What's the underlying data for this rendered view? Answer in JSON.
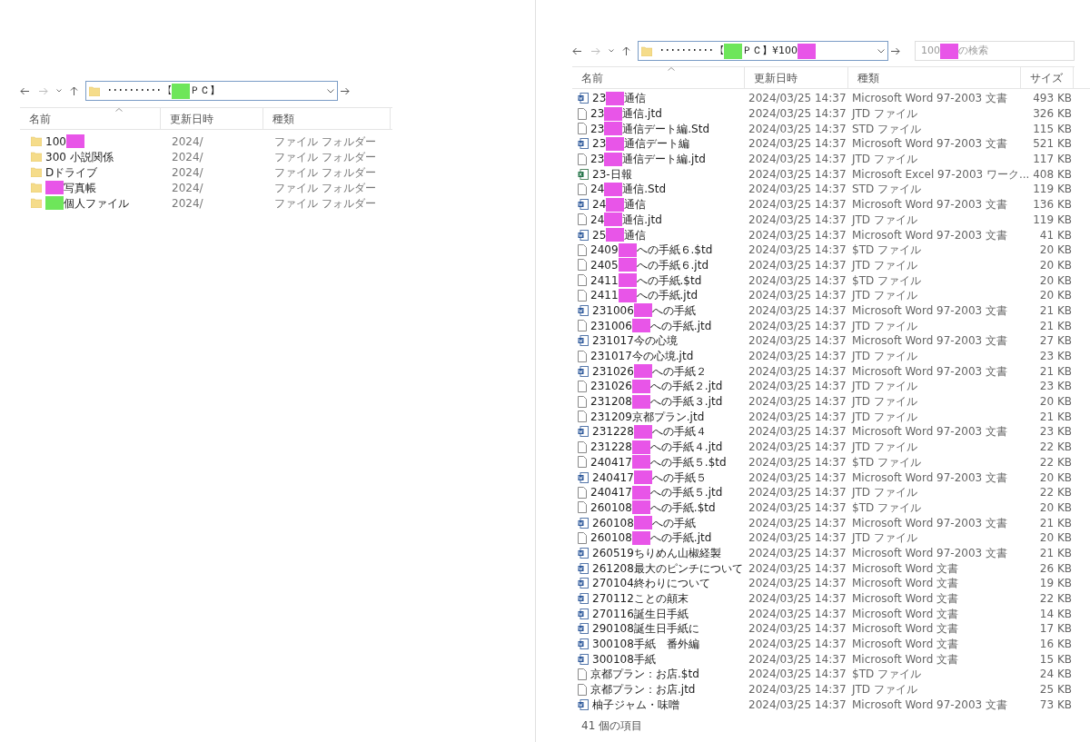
{
  "left_window": {
    "address": {
      "segments": [
        {
          "kind": "text",
          "text": "･･････････【"
        },
        {
          "kind": "redaction",
          "color": "#6ee65a"
        },
        {
          "kind": "text",
          "text": "ＰＣ】"
        }
      ]
    },
    "columns": [
      "名前",
      "更新日時",
      "種類"
    ],
    "rows": [
      {
        "kind": "folder",
        "name": "100",
        "color": "#e855e8",
        "date": "2024/",
        "type": "ファイル フォルダー"
      },
      {
        "kind": "folder",
        "name": "300 小説関係",
        "date": "2024/",
        "type": "ファイル フォルダー"
      },
      {
        "kind": "folder",
        "name": "Dドライブ",
        "date": "2024/",
        "type": "ファイル フォルダー"
      },
      {
        "kind": "folder",
        "color": "#e855e8",
        "name_end": "写真帳",
        "date": "2024/",
        "type": "ファイル フォルダー"
      },
      {
        "kind": "folder",
        "color": "#6ee65a",
        "name_end": "個人ファイル",
        "date": "2024/",
        "type": "ファイル フォルダー"
      }
    ]
  },
  "right_window": {
    "address": {
      "segments": [
        {
          "kind": "text",
          "text": "･･････････【"
        },
        {
          "kind": "redaction",
          "color": "#6ee65a"
        },
        {
          "kind": "text",
          "text": "ＰＣ】¥100"
        },
        {
          "kind": "redaction",
          "color": "#e855e8"
        }
      ]
    },
    "search": {
      "segments": [
        {
          "kind": "text",
          "text": "100"
        },
        {
          "kind": "redaction",
          "color": "#e855e8"
        },
        {
          "kind": "text",
          "text": "の検索"
        }
      ]
    },
    "columns": [
      "名前",
      "更新日時",
      "種類",
      "サイズ"
    ],
    "rows": [
      {
        "kind": "word",
        "name": "23",
        "color": "#e855e8",
        "name_end": "通信",
        "date": "2024/03/25 14:37",
        "type": "Microsoft Word 97-2003 文書",
        "size": "493 KB"
      },
      {
        "kind": "file",
        "name": "23",
        "color": "#e855e8",
        "name_end": "通信.jtd",
        "date": "2024/03/25 14:37",
        "type": "JTD ファイル",
        "size": "326 KB"
      },
      {
        "kind": "file",
        "name": "23",
        "color": "#e855e8",
        "name_end": "通信デート編.Std",
        "date": "2024/03/25 14:37",
        "type": "STD ファイル",
        "size": "115 KB"
      },
      {
        "kind": "word",
        "name": "23",
        "color": "#e855e8",
        "name_end": "通信デート編",
        "date": "2024/03/25 14:37",
        "type": "Microsoft Word 97-2003 文書",
        "size": "521 KB"
      },
      {
        "kind": "file",
        "name": "23",
        "color": "#e855e8",
        "name_end": "通信デート編.jtd",
        "date": "2024/03/25 14:37",
        "type": "JTD ファイル",
        "size": "117 KB"
      },
      {
        "kind": "excel",
        "name": "23-日報",
        "date": "2024/03/25 14:37",
        "type": "Microsoft Excel 97-2003 ワーク...",
        "size": "408 KB"
      },
      {
        "kind": "file",
        "name": "24",
        "color": "#e855e8",
        "name_end": "通信.Std",
        "date": "2024/03/25 14:37",
        "type": "STD ファイル",
        "size": "119 KB"
      },
      {
        "kind": "word",
        "name": "24",
        "color": "#e855e8",
        "name_end": "通信",
        "date": "2024/03/25 14:37",
        "type": "Microsoft Word 97-2003 文書",
        "size": "136 KB"
      },
      {
        "kind": "file",
        "name": "24",
        "color": "#e855e8",
        "name_end": "通信.jtd",
        "date": "2024/03/25 14:37",
        "type": "JTD ファイル",
        "size": "119 KB"
      },
      {
        "kind": "word",
        "name": "25",
        "color": "#e855e8",
        "name_end": "通信",
        "date": "2024/03/25 14:37",
        "type": "Microsoft Word 97-2003 文書",
        "size": "41 KB"
      },
      {
        "kind": "file",
        "name": "2409",
        "color": "#e855e8",
        "name_end": "への手紙６.$td",
        "date": "2024/03/25 14:37",
        "type": "$TD ファイル",
        "size": "20 KB"
      },
      {
        "kind": "file",
        "name": "2405",
        "color": "#e855e8",
        "name_end": "への手紙６.jtd",
        "date": "2024/03/25 14:37",
        "type": "JTD ファイル",
        "size": "20 KB"
      },
      {
        "kind": "file",
        "name": "2411",
        "color": "#e855e8",
        "name_end": "への手紙.$td",
        "date": "2024/03/25 14:37",
        "type": "$TD ファイル",
        "size": "20 KB"
      },
      {
        "kind": "file",
        "name": "2411",
        "color": "#e855e8",
        "name_end": "への手紙.jtd",
        "date": "2024/03/25 14:37",
        "type": "JTD ファイル",
        "size": "20 KB"
      },
      {
        "kind": "word",
        "name": "231006",
        "color": "#e855e8",
        "name_end": "への手紙",
        "date": "2024/03/25 14:37",
        "type": "Microsoft Word 97-2003 文書",
        "size": "21 KB"
      },
      {
        "kind": "file",
        "name": "231006",
        "color": "#e855e8",
        "name_end": "への手紙.jtd",
        "date": "2024/03/25 14:37",
        "type": "JTD ファイル",
        "size": "21 KB"
      },
      {
        "kind": "word",
        "name": "231017今の心境",
        "date": "2024/03/25 14:37",
        "type": "Microsoft Word 97-2003 文書",
        "size": "27 KB"
      },
      {
        "kind": "file",
        "name": "231017今の心境.jtd",
        "date": "2024/03/25 14:37",
        "type": "JTD ファイル",
        "size": "23 KB"
      },
      {
        "kind": "word",
        "name": "231026",
        "color": "#e855e8",
        "name_end": "への手紙２",
        "date": "2024/03/25 14:37",
        "type": "Microsoft Word 97-2003 文書",
        "size": "21 KB"
      },
      {
        "kind": "file",
        "name": "231026",
        "color": "#e855e8",
        "name_end": "への手紙２.jtd",
        "date": "2024/03/25 14:37",
        "type": "JTD ファイル",
        "size": "23 KB"
      },
      {
        "kind": "file",
        "name": "231208",
        "color": "#e855e8",
        "name_end": "への手紙３.jtd",
        "date": "2024/03/25 14:37",
        "type": "JTD ファイル",
        "size": "20 KB"
      },
      {
        "kind": "file",
        "name": "231209京都プラン.jtd",
        "date": "2024/03/25 14:37",
        "type": "JTD ファイル",
        "size": "21 KB"
      },
      {
        "kind": "word",
        "name": "231228",
        "color": "#e855e8",
        "name_end": "への手紙４",
        "date": "2024/03/25 14:37",
        "type": "Microsoft Word 97-2003 文書",
        "size": "23 KB"
      },
      {
        "kind": "file",
        "name": "231228",
        "color": "#e855e8",
        "name_end": "への手紙４.jtd",
        "date": "2024/03/25 14:37",
        "type": "JTD ファイル",
        "size": "22 KB"
      },
      {
        "kind": "file",
        "name": "240417",
        "color": "#e855e8",
        "name_end": "への手紙５.$td",
        "date": "2024/03/25 14:37",
        "type": "$TD ファイル",
        "size": "22 KB"
      },
      {
        "kind": "word",
        "name": "240417",
        "color": "#e855e8",
        "name_end": "への手紙５",
        "date": "2024/03/25 14:37",
        "type": "Microsoft Word 97-2003 文書",
        "size": "20 KB"
      },
      {
        "kind": "file",
        "name": "240417",
        "color": "#e855e8",
        "name_end": "への手紙５.jtd",
        "date": "2024/03/25 14:37",
        "type": "JTD ファイル",
        "size": "22 KB"
      },
      {
        "kind": "file",
        "name": "260108",
        "color": "#e855e8",
        "name_end": "への手紙.$td",
        "date": "2024/03/25 14:37",
        "type": "$TD ファイル",
        "size": "20 KB"
      },
      {
        "kind": "word",
        "name": "260108",
        "color": "#e855e8",
        "name_end": "への手紙",
        "date": "2024/03/25 14:37",
        "type": "Microsoft Word 97-2003 文書",
        "size": "21 KB"
      },
      {
        "kind": "file",
        "name": "260108",
        "color": "#e855e8",
        "name_end": "への手紙.jtd",
        "date": "2024/03/25 14:37",
        "type": "JTD ファイル",
        "size": "20 KB"
      },
      {
        "kind": "word",
        "name": "260519ちりめん山椒経製",
        "date": "2024/03/25 14:37",
        "type": "Microsoft Word 97-2003 文書",
        "size": "21 KB"
      },
      {
        "kind": "word",
        "name": "261208最大のピンチについて",
        "date": "2024/03/25 14:37",
        "type": "Microsoft Word 文書",
        "size": "26 KB"
      },
      {
        "kind": "word",
        "name": "270104終わりについて",
        "date": "2024/03/25 14:37",
        "type": "Microsoft Word 文書",
        "size": "19 KB"
      },
      {
        "kind": "word",
        "name": "270112ことの顛末",
        "date": "2024/03/25 14:37",
        "type": "Microsoft Word 文書",
        "size": "22 KB"
      },
      {
        "kind": "word",
        "name": "270116誕生日手紙",
        "date": "2024/03/25 14:37",
        "type": "Microsoft Word 文書",
        "size": "14 KB"
      },
      {
        "kind": "word",
        "name": "290108誕生日手紙に",
        "date": "2024/03/25 14:37",
        "type": "Microsoft Word 文書",
        "size": "17 KB"
      },
      {
        "kind": "word",
        "name": "300108手紙　番外編",
        "date": "2024/03/25 14:37",
        "type": "Microsoft Word 文書",
        "size": "16 KB"
      },
      {
        "kind": "word",
        "name": "300108手紙",
        "date": "2024/03/25 14:37",
        "type": "Microsoft Word 文書",
        "size": "15 KB"
      },
      {
        "kind": "file",
        "name": "京都プラン：お店.$td",
        "date": "2024/03/25 14:37",
        "type": "$TD ファイル",
        "size": "24 KB"
      },
      {
        "kind": "file",
        "name": "京都プラン：お店.jtd",
        "date": "2024/03/25 14:37",
        "type": "JTD ファイル",
        "size": "25 KB"
      },
      {
        "kind": "word",
        "name": "柚子ジャム・味噌",
        "date": "2024/03/25 14:37",
        "type": "Microsoft Word 97-2003 文書",
        "size": "73 KB"
      }
    ],
    "status": "41 個の項目"
  }
}
